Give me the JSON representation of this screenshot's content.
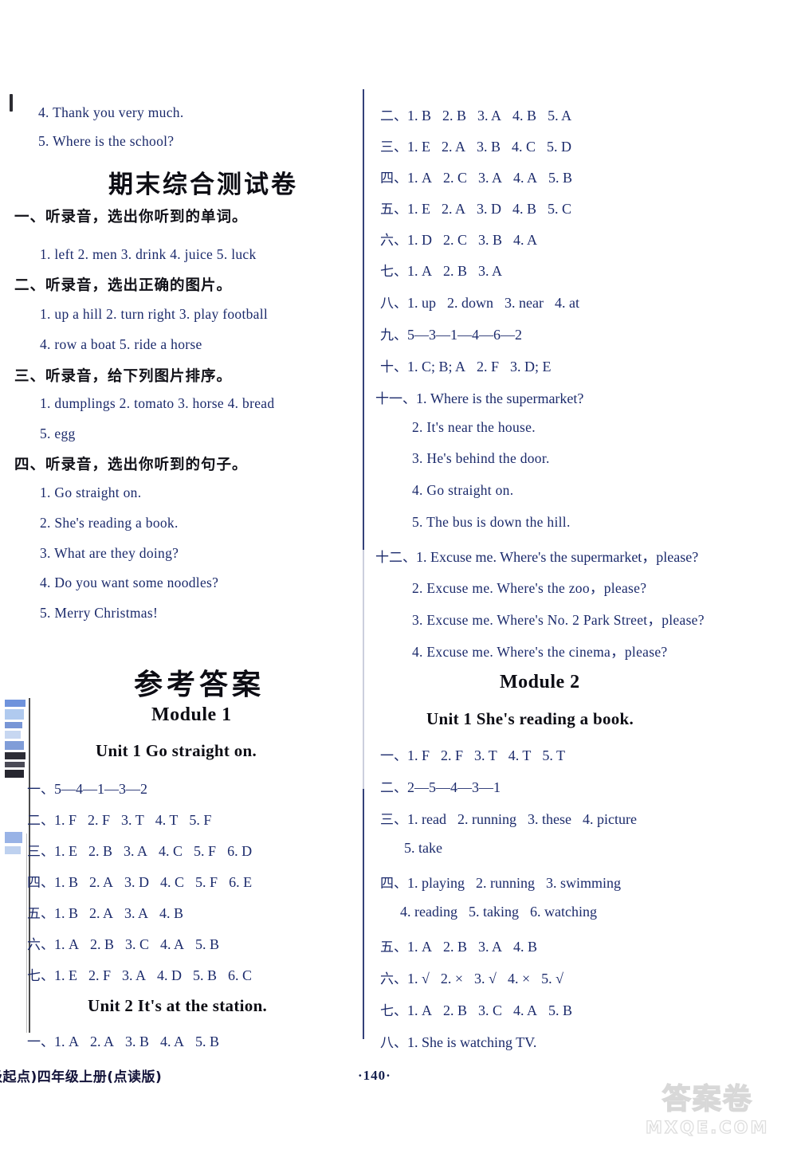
{
  "page": {
    "number": "·140·",
    "footer_text": "级起点)四年级上册(点读版)",
    "watermark_cn": "答案卷",
    "watermark_en": "MXQE.COM",
    "text_color": "#1b2a6b",
    "heading_color": "#0d0d14"
  },
  "left_column": {
    "carryover_sentences": [
      "4. Thank you very much.",
      "5. Where is the school?"
    ],
    "exam_title": "期末综合测试卷",
    "exam_sections": [
      {
        "heading": "一、听录音，选出你听到的单词。",
        "lines": [
          "1. left   2. men   3. drink   4. juice   5. luck"
        ]
      },
      {
        "heading": "二、听录音，选出正确的图片。",
        "lines": [
          "1. up a hill   2. turn right   3. play football",
          "4. row a boat   5. ride a horse"
        ]
      },
      {
        "heading": "三、听录音，给下列图片排序。",
        "lines": [
          "1. dumplings   2. tomato   3. horse   4. bread",
          "5. egg"
        ]
      },
      {
        "heading": "四、听录音，选出你听到的句子。",
        "lines": [
          "1. Go straight on.",
          "2. She's reading a book.",
          "3. What are they doing?",
          "4. Do you want some noodles?",
          "5. Merry Christmas!"
        ]
      }
    ],
    "answers_title": "参考答案",
    "module_1": "Module 1",
    "unit_1_heading": "Unit 1    Go straight on.",
    "unit_1_answers": [
      {
        "ord": "一、",
        "items": [
          "5—4—1—3—2"
        ]
      },
      {
        "ord": "二、",
        "items": [
          "1. F",
          "2. F",
          "3. T",
          "4. T",
          "5. F"
        ]
      },
      {
        "ord": "三、",
        "items": [
          "1. E",
          "2. B",
          "3. A",
          "4. C",
          "5. F",
          "6. D"
        ]
      },
      {
        "ord": "四、",
        "items": [
          "1. B",
          "2. A",
          "3. D",
          "4. C",
          "5. F",
          "6. E"
        ]
      },
      {
        "ord": "五、",
        "items": [
          "1. B",
          "2. A",
          "3. A",
          "4. B"
        ]
      },
      {
        "ord": "六、",
        "items": [
          "1. A",
          "2. B",
          "3. C",
          "4. A",
          "5. B"
        ]
      },
      {
        "ord": "七、",
        "items": [
          "1. E",
          "2. F",
          "3. A",
          "4. D",
          "5. B",
          "6. C"
        ]
      }
    ],
    "unit_2_heading": "Unit 2    It's at the station.",
    "unit_2_answers": [
      {
        "ord": "一、",
        "items": [
          "1. A",
          "2. A",
          "3. B",
          "4. A",
          "5. B"
        ]
      }
    ]
  },
  "right_column": {
    "unit_2_answers_cont": [
      {
        "ord": "二、",
        "items": [
          "1. B",
          "2. B",
          "3. A",
          "4. B",
          "5. A"
        ]
      },
      {
        "ord": "三、",
        "items": [
          "1. E",
          "2. A",
          "3. B",
          "4. C",
          "5. D"
        ]
      },
      {
        "ord": "四、",
        "items": [
          "1. A",
          "2. C",
          "3. A",
          "4. A",
          "5. B"
        ]
      },
      {
        "ord": "五、",
        "items": [
          "1. E",
          "2. A",
          "3. D",
          "4. B",
          "5. C"
        ]
      },
      {
        "ord": "六、",
        "items": [
          "1. D",
          "2. C",
          "3. B",
          "4. A"
        ]
      },
      {
        "ord": "七、",
        "items": [
          "1. A",
          "2. B",
          "3. A"
        ]
      },
      {
        "ord": "八、",
        "items": [
          "1. up",
          "2. down",
          "3. near",
          "4. at"
        ]
      },
      {
        "ord": "九、",
        "items": [
          "5—3—1—4—6—2"
        ]
      },
      {
        "ord": "十、",
        "items": [
          "1. C; B; A",
          "2. F",
          "3. D; E"
        ]
      }
    ],
    "section_11": {
      "ord": "十一、",
      "first": "1. Where is the supermarket?",
      "rest": [
        "2. It's near the house.",
        "3. He's behind the door.",
        "4. Go straight on.",
        "5. The bus is down the hill."
      ]
    },
    "section_12": {
      "ord": "十二、",
      "first": "1. Excuse me. Where's the supermarket，please?",
      "rest": [
        "2. Excuse me. Where's the zoo，please?",
        "3. Excuse me. Where's No. 2 Park Street，please?",
        "4. Excuse me. Where's the cinema，please?"
      ]
    },
    "module_2": "Module 2",
    "unit_1_heading": "Unit 1    She's reading a book.",
    "unit_1_answers": [
      {
        "ord": "一、",
        "items": [
          "1. F",
          "2. F",
          "3. T",
          "4. T",
          "5. T"
        ]
      },
      {
        "ord": "二、",
        "items": [
          "2—5—4—3—1"
        ]
      },
      {
        "ord": "三、",
        "items": [
          "1. read",
          "2. running",
          "3. these",
          "4. picture"
        ]
      },
      {
        "ord": "",
        "items": [
          "5. take"
        ]
      },
      {
        "ord": "四、",
        "items": [
          "1. playing",
          "2. running",
          "3. swimming"
        ]
      },
      {
        "ord": "",
        "items": [
          "4. reading",
          "5. taking",
          "6. watching"
        ]
      },
      {
        "ord": "五、",
        "items": [
          "1. A",
          "2. B",
          "3. A",
          "4. B"
        ]
      },
      {
        "ord": "六、",
        "items": [
          "1. √",
          "2. ×",
          "3. √",
          "4. ×",
          "5. √"
        ]
      },
      {
        "ord": "七、",
        "items": [
          "1. A",
          "2. B",
          "3. C",
          "4. A",
          "5. B"
        ]
      },
      {
        "ord": "八、",
        "items": [
          "1. She is watching TV."
        ]
      }
    ]
  }
}
